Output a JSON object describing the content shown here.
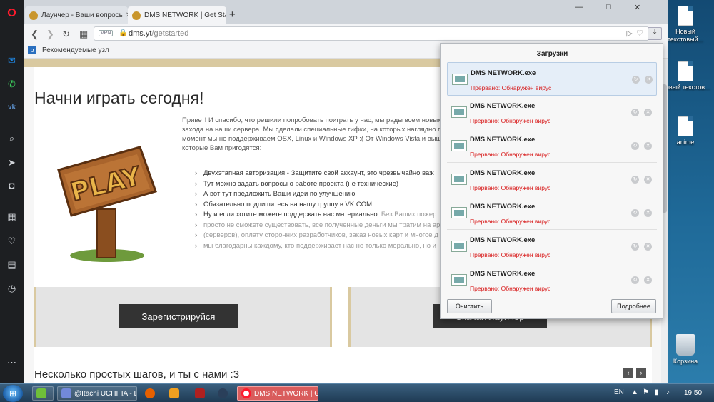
{
  "browser": {
    "tabs": [
      {
        "label": "Лаунчер - Ваши вопрось",
        "active": false
      },
      {
        "label": "DMS NETWORK | Get Star",
        "active": true
      }
    ],
    "new_tab": "+",
    "window_controls": {
      "minimize": "—",
      "maximize": "□",
      "close": "✕"
    },
    "address": {
      "vpn": "VPN",
      "host": "dms.yt",
      "path": "/getstarted"
    },
    "bookmarks_label": "Рекомендуемые узл"
  },
  "sidebar": {
    "brand_icon": "opera-icon",
    "items": [
      "messenger-icon",
      "whatsapp-icon",
      "vk-icon",
      "search-icon",
      "send-icon",
      "camera-icon",
      "grid-icon",
      "heart-icon",
      "news-icon",
      "clock-icon",
      "more-icon"
    ]
  },
  "page": {
    "heading": "Начни играть сегодня!",
    "intro": "Привет! И спасибо, что решили попробовать поиграть у нас, мы рады всем новым захода на наши сервера. Мы сделали специальные гифки, на которых наглядно п момент мы не поддерживаем OSX, Linux и Windows XP :( От Windows Vista и выш которые Вам пригодятся:",
    "bullets": [
      "Двухэтапная авторизация - Защитите свой аккаунт, это чрезвычайно важ",
      "Тут можно задать вопросы о работе проекта (не технические)",
      "А вот тут предложить Ваши идеи по улучшению",
      "Обязательно подпишитесь на нашу группу в VK.COM"
    ],
    "support_lead": "Ну и если хотите можете поддержать нас материально.",
    "support_muted_1": " Без Ваших пожер",
    "support_lines": [
      "просто не сможете существовать, все полученные деньги мы тратим на ар",
      "(серверов), оплату сторонних разработчиков, заказ новых карт и многое д",
      "мы благодарны каждому, кто поддерживает нас не только морально, но и"
    ],
    "sign_text": "PLAY",
    "register_button": "Зарегистрируйся",
    "launcher_button": "Скачай лаунчер",
    "subheading": "Несколько простых шагов, и ты с нами :3",
    "pager_prev": "‹",
    "pager_next": "›"
  },
  "downloads": {
    "title": "Загрузки",
    "items": [
      {
        "name": "DMS NETWORK.exe",
        "status": "Прервано: Обнаружен вирус"
      },
      {
        "name": "DMS NETWORK.exe",
        "status": "Прервано: Обнаружен вирус"
      },
      {
        "name": "DMS NETWORK.exe",
        "status": "Прервано: Обнаружен вирус"
      },
      {
        "name": "DMS NETWORK.exe",
        "status": "Прервано: Обнаружен вирус"
      },
      {
        "name": "DMS NETWORK.exe",
        "status": "Прервано: Обнаружен вирус"
      },
      {
        "name": "DMS NETWORK.exe",
        "status": "Прервано: Обнаружен вирус"
      },
      {
        "name": "DMS NETWORK.exe",
        "status": "Прервано: Обнаружен вирус"
      }
    ],
    "clear_button": "Очистить",
    "details_button": "Подробнее"
  },
  "desktop_icons": [
    {
      "label": "Новый текстовый..."
    },
    {
      "label": "Новый текстов..."
    },
    {
      "label": "anime"
    },
    {
      "label": "Корзина"
    }
  ],
  "taskbar": {
    "items": [
      {
        "label": "",
        "icon": "utorrent-icon"
      },
      {
        "label": "@Itachi UCHIHA - Di...",
        "icon": "discord-icon"
      },
      {
        "label": "",
        "icon": "firefox-icon"
      },
      {
        "label": "",
        "icon": "media-player-icon"
      },
      {
        "label": "",
        "icon": "app-icon"
      },
      {
        "label": "",
        "icon": "steam-icon"
      },
      {
        "label": "DMS NETWORK | Get...",
        "icon": "opera-icon"
      }
    ],
    "language": "EN",
    "time": "19:50"
  },
  "colors": {
    "accent_red": "#d81b1b",
    "dark_button": "#333333",
    "gold_border": "#d9c9a0"
  }
}
